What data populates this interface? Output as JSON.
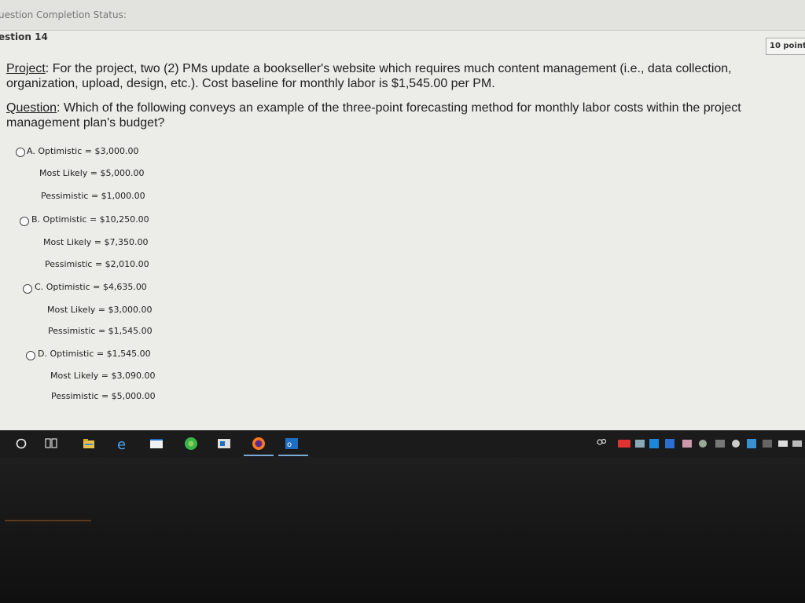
{
  "status": {
    "label": "uestion Completion Status:"
  },
  "question_header": {
    "label": "estion 14",
    "points": "10 point"
  },
  "project": {
    "label": "Project",
    "text": ": For the project, two (2) PMs update a bookseller's website which requires much content management (i.e., data collection, organization, upload, design, etc.). Cost baseline for monthly labor is $1,545.00 per PM."
  },
  "question": {
    "label": "Question",
    "text": ": Which of the following conveys an example of the three-point forecasting method for monthly labor costs within the project management plan's budget?"
  },
  "options": [
    {
      "letter": "A.",
      "optimistic": "Optimistic = $3,000.00",
      "most_likely": "Most Likely = $5,000.00",
      "pessimistic": "Pessimistic = $1,000.00"
    },
    {
      "letter": "B.",
      "optimistic": "Optimistic = $10,250.00",
      "most_likely": "Most Likely = $7,350.00",
      "pessimistic": "Pessimistic = $2,010.00"
    },
    {
      "letter": "C.",
      "optimistic": "Optimistic = $4,635.00",
      "most_likely": "Most Likely = $3,000.00",
      "pessimistic": "Pessimistic = $1,545.00"
    },
    {
      "letter": "D.",
      "optimistic": "Optimistic = $1,545.00",
      "most_likely": "Most Likely = $3,090.00",
      "pessimistic": "Pessimistic = $5,000.00"
    }
  ],
  "taskbar": {
    "icons": [
      "start-icon",
      "task-view-icon",
      "file-explorer-icon",
      "edge-icon",
      "window-icon",
      "chrome-icon",
      "app-icon",
      "firefox-icon",
      "outlook-icon"
    ],
    "tray_icons": [
      "people-icon",
      "tray-icons"
    ]
  },
  "colors": {
    "page_bg": "#ecece8",
    "taskbar": "#1b1b1b",
    "firefox": "#ff7a1a",
    "outlook": "#1e6fc2",
    "chrome": "#39b54a"
  }
}
